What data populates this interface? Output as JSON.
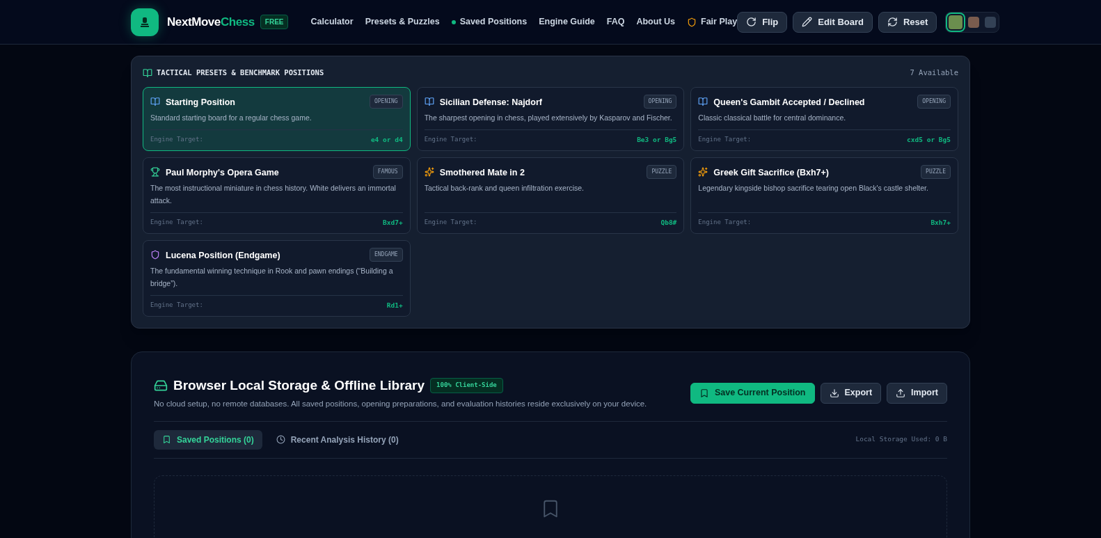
{
  "brand": {
    "name_part1": "NextMove",
    "name_part2": "Chess",
    "badge": "FREE"
  },
  "nav": [
    {
      "label": "Calculator",
      "kind": "text"
    },
    {
      "label": "Presets & Puzzles",
      "kind": "text"
    },
    {
      "label": "Saved Positions",
      "kind": "dot"
    },
    {
      "label": "Engine Guide",
      "kind": "text"
    },
    {
      "label": "FAQ",
      "kind": "text"
    },
    {
      "label": "About Us",
      "kind": "text"
    },
    {
      "label": "Fair Play",
      "kind": "shield"
    }
  ],
  "header_buttons": [
    {
      "label": "Flip",
      "kind": "rotate"
    },
    {
      "label": "Edit Board",
      "kind": "pencil"
    },
    {
      "label": "Reset",
      "kind": "refresh"
    }
  ],
  "board_themes": [
    {
      "color": "#6b8e4e",
      "selected": true
    },
    {
      "color": "#7a5c4e",
      "selected": false
    },
    {
      "color": "#334155",
      "selected": false
    }
  ],
  "presets": {
    "title": "TACTICAL PRESETS & BENCHMARK POSITIONS",
    "count": "7 Available",
    "cards": [
      {
        "title": "Starting Position",
        "tag": "OPENING",
        "kind": "opening",
        "description": "Standard starting board for a regular chess game.",
        "target_label": "Engine Target:",
        "target": "e4 or d4",
        "selected": true
      },
      {
        "title": "Sicilian Defense: Najdorf",
        "tag": "OPENING",
        "kind": "opening",
        "description": "The sharpest opening in chess, played extensively by Kasparov and Fischer.",
        "target_label": "Engine Target:",
        "target": "Be3 or Bg5",
        "selected": false
      },
      {
        "title": "Queen's Gambit Accepted / Declined",
        "tag": "OPENING",
        "kind": "opening",
        "description": "Classic classical battle for central dominance.",
        "target_label": "Engine Target:",
        "target": "cxd5 or Bg5",
        "selected": false
      },
      {
        "title": "Paul Morphy's Opera Game",
        "tag": "FAMOUS",
        "kind": "famous",
        "description": "The most instructional miniature in chess history. White delivers an immortal attack.",
        "target_label": "Engine Target:",
        "target": "Bxd7+",
        "selected": false
      },
      {
        "title": "Smothered Mate in 2",
        "tag": "PUZZLE",
        "kind": "puzzle",
        "description": "Tactical back-rank and queen infiltration exercise.",
        "target_label": "Engine Target:",
        "target": "Qb8#",
        "selected": false
      },
      {
        "title": "Greek Gift Sacrifice (Bxh7+)",
        "tag": "PUZZLE",
        "kind": "puzzle",
        "description": "Legendary kingside bishop sacrifice tearing open Black's castle shelter.",
        "target_label": "Engine Target:",
        "target": "Bxh7+",
        "selected": false
      },
      {
        "title": "Lucena Position (Endgame)",
        "tag": "ENDGAME",
        "kind": "endgame",
        "description": "The fundamental winning technique in Rook and pawn endings (“Building a bridge”).",
        "target_label": "Engine Target:",
        "target": "Rd1+",
        "selected": false
      }
    ]
  },
  "storage": {
    "title": "Browser Local Storage & Offline Library",
    "badge": "100% Client-Side",
    "description": "No cloud setup, no remote databases. All saved positions, opening preparations, and evaluation histories reside exclusively on your device.",
    "buttons": [
      {
        "label": "Save Current Position",
        "kind": "primary"
      },
      {
        "label": "Export",
        "kind": "download"
      },
      {
        "label": "Import",
        "kind": "upload"
      }
    ],
    "tabs": [
      {
        "label": "Saved Positions (0)",
        "kind": "bookmark",
        "selected": true
      },
      {
        "label": "Recent Analysis History (0)",
        "kind": "clock",
        "selected": false
      }
    ],
    "usage": "Local Storage Used: 0 B"
  }
}
